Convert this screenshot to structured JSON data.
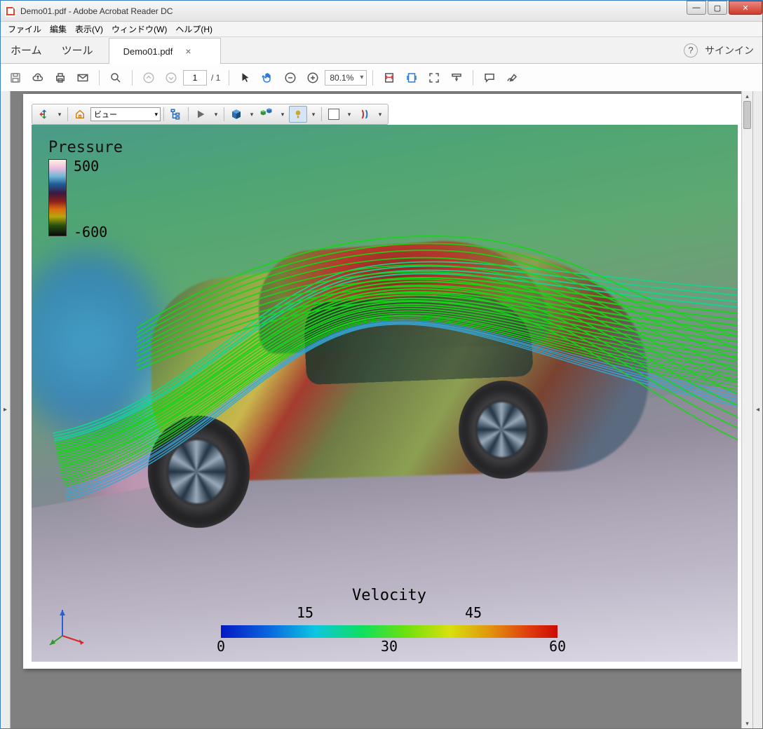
{
  "window": {
    "title": "Demo01.pdf - Adobe Acrobat Reader DC"
  },
  "menubar": {
    "file": "ファイル",
    "edit": "編集",
    "view": "表示(V)",
    "window": "ウィンドウ(W)",
    "help": "ヘルプ(H)"
  },
  "tabbar": {
    "home": "ホーム",
    "tools": "ツール",
    "doc": "Demo01.pdf",
    "signin": "サインイン"
  },
  "toolbar": {
    "page_current": "1",
    "page_total": "/ 1",
    "zoom": "80.1%"
  },
  "toolbar3d": {
    "view_selected": "ビュー"
  },
  "chart_data": {
    "pressure_legend": {
      "title": "Pressure",
      "max": 500,
      "min": -600
    },
    "velocity_legend": {
      "title": "Velocity",
      "ticks": [
        0,
        15,
        30,
        45,
        60
      ],
      "min": 0,
      "max": 60
    }
  }
}
